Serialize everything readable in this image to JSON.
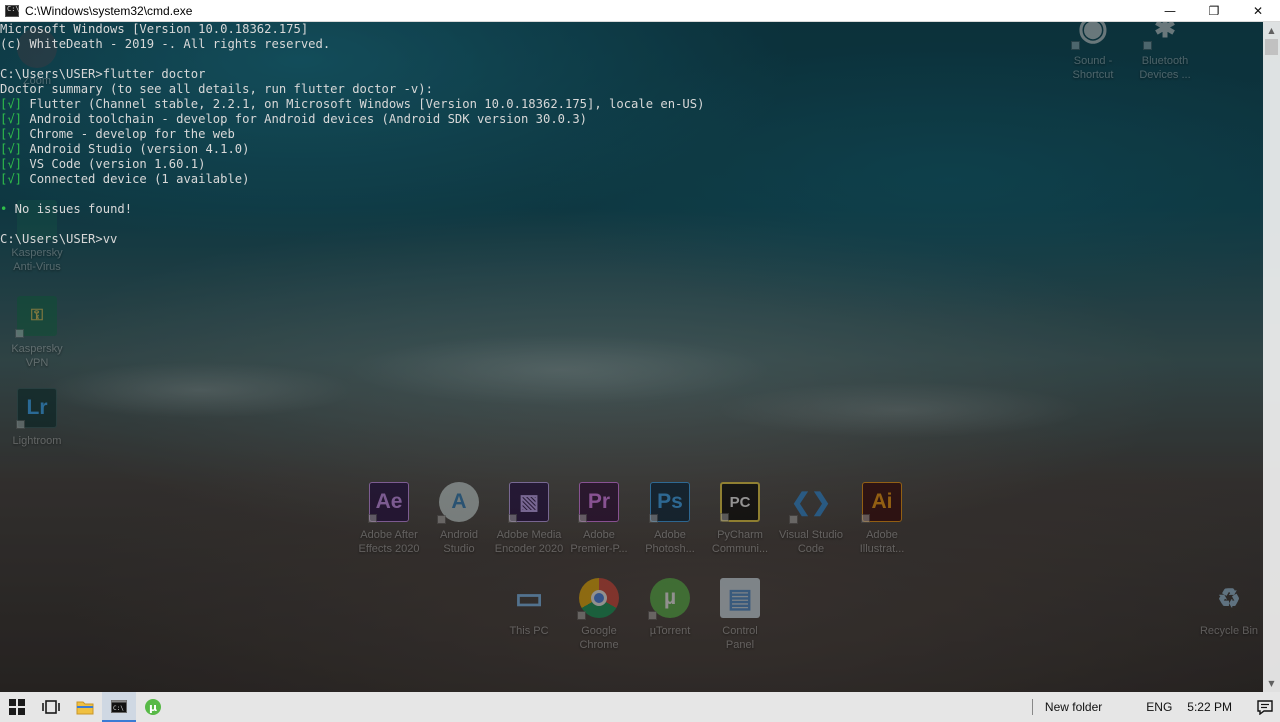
{
  "window": {
    "title": "C:\\Windows\\system32\\cmd.exe",
    "minimize": "—",
    "maximize": "❐",
    "close": "✕"
  },
  "console": {
    "lines": [
      {
        "tag": "",
        "text": "Microsoft Windows [Version 10.0.18362.175]"
      },
      {
        "tag": "",
        "text": "(c) WhiteDeath - 2019 -. All rights reserved."
      },
      {
        "tag": "",
        "text": ""
      },
      {
        "tag": "",
        "text": "C:\\Users\\USER>flutter doctor"
      },
      {
        "tag": "",
        "text": "Doctor summary (to see all details, run flutter doctor -v):"
      },
      {
        "tag": "[√]",
        "text": " Flutter (Channel stable, 2.2.1, on Microsoft Windows [Version 10.0.18362.175], locale en-US)"
      },
      {
        "tag": "[√]",
        "text": " Android toolchain - develop for Android devices (Android SDK version 30.0.3)"
      },
      {
        "tag": "[√]",
        "text": " Chrome - develop for the web"
      },
      {
        "tag": "[√]",
        "text": " Android Studio (version 4.1.0)"
      },
      {
        "tag": "[√]",
        "text": " VS Code (version 1.60.1)"
      },
      {
        "tag": "[√]",
        "text": " Connected device (1 available)"
      },
      {
        "tag": "",
        "text": ""
      },
      {
        "tag": "•",
        "text": " No issues found!"
      },
      {
        "tag": "",
        "text": ""
      },
      {
        "tag": "",
        "text": "C:\\Users\\USER>vv"
      }
    ]
  },
  "desktop": {
    "left_icons": [
      {
        "label": "Zoom",
        "glyph": "",
        "color": "#2d8cff"
      },
      {
        "label": "Kaspersky Anti-Virus",
        "glyph": "",
        "color": "#1e8a5a"
      },
      {
        "label": "Kaspersky VPN",
        "glyph": "🔒",
        "color": "#1e8a5a"
      },
      {
        "label": "Lightroom",
        "glyph": "Lr",
        "color": "#31a8ff"
      }
    ],
    "top_right_icons": [
      {
        "label": "Sound - Shortcut",
        "glyph": "◉"
      },
      {
        "label": "Bluetooth Devices ...",
        "glyph": "✱"
      }
    ],
    "row1": [
      {
        "label": "Adobe After Effects 2020",
        "glyph": "Ae",
        "color": "#d291ff",
        "bg": "#1f0740"
      },
      {
        "label": "Android Studio",
        "glyph": "A",
        "color": "#3ddc84",
        "bg": "#c9d6d6"
      },
      {
        "label": "Adobe Media Encoder 2020",
        "glyph": "▧",
        "color": "#c7a6ff",
        "bg": "#1f0740"
      },
      {
        "label": "Adobe Premier-P...",
        "glyph": "Pr",
        "color": "#e77bff",
        "bg": "#2a0634"
      },
      {
        "label": "Adobe Photosh...",
        "glyph": "Ps",
        "color": "#31a8ff",
        "bg": "#001e36"
      },
      {
        "label": "PyCharm Communi...",
        "glyph": "PC",
        "color": "#ffffff",
        "bg": "#000000"
      },
      {
        "label": "Visual Studio Code",
        "glyph": "❮❯",
        "color": "#2a8de0",
        "bg": "transparent"
      },
      {
        "label": "Adobe Illustrat...",
        "glyph": "Ai",
        "color": "#ff9a00",
        "bg": "#330000"
      }
    ],
    "row2": [
      {
        "label": "This PC",
        "glyph": "▭",
        "color": "#7fc3ff",
        "bg": "transparent"
      },
      {
        "label": "Google Chrome",
        "glyph": "◎",
        "color": "#ffffff",
        "bg": "transparent"
      },
      {
        "label": "µTorrent",
        "glyph": "µ",
        "color": "#ffffff",
        "bg": "#58b947"
      },
      {
        "label": "Control Panel",
        "glyph": "▤",
        "color": "#4a90d9",
        "bg": "#d6e6f2"
      }
    ],
    "recycle_bin": {
      "label": "Recycle Bin",
      "glyph": "♻"
    }
  },
  "taskbar": {
    "start_icon": "start-icon",
    "tray_folder": "New folder",
    "language": "ENG",
    "time": "5:22 PM"
  }
}
